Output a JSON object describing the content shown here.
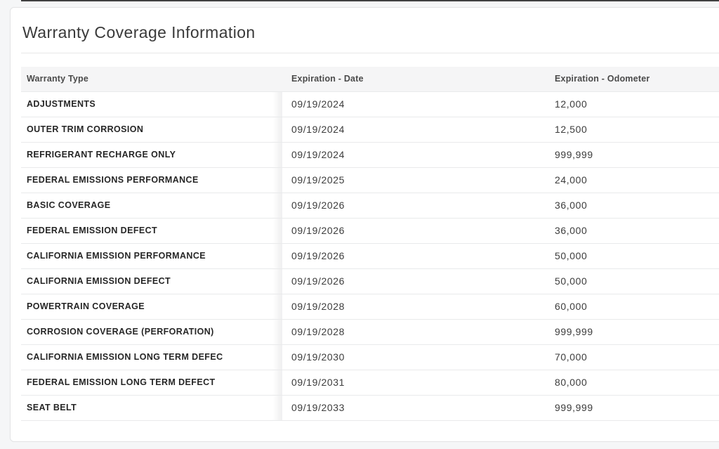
{
  "page": {
    "title": "Warranty Coverage Information"
  },
  "table": {
    "columns": [
      {
        "id": "type",
        "label": "Warranty Type"
      },
      {
        "id": "date",
        "label": "Expiration - Date"
      },
      {
        "id": "odometer",
        "label": "Expiration - Odometer"
      }
    ],
    "rows": [
      {
        "type": "ADJUSTMENTS",
        "date": "09/19/2024",
        "odometer": "12,000"
      },
      {
        "type": "OUTER TRIM CORROSION",
        "date": "09/19/2024",
        "odometer": "12,500"
      },
      {
        "type": "REFRIGERANT RECHARGE ONLY",
        "date": "09/19/2024",
        "odometer": "999,999"
      },
      {
        "type": "FEDERAL EMISSIONS PERFORMANCE",
        "date": "09/19/2025",
        "odometer": "24,000"
      },
      {
        "type": "BASIC COVERAGE",
        "date": "09/19/2026",
        "odometer": "36,000"
      },
      {
        "type": "FEDERAL EMISSION DEFECT",
        "date": "09/19/2026",
        "odometer": "36,000"
      },
      {
        "type": "CALIFORNIA EMISSION PERFORMANCE",
        "date": "09/19/2026",
        "odometer": "50,000"
      },
      {
        "type": "CALIFORNIA EMISSION DEFECT",
        "date": "09/19/2026",
        "odometer": "50,000"
      },
      {
        "type": "POWERTRAIN COVERAGE",
        "date": "09/19/2028",
        "odometer": "60,000"
      },
      {
        "type": "CORROSION COVERAGE (PERFORATION)",
        "date": "09/19/2028",
        "odometer": "999,999"
      },
      {
        "type": "CALIFORNIA EMISSION LONG TERM DEFEC",
        "date": "09/19/2030",
        "odometer": "70,000"
      },
      {
        "type": "FEDERAL EMISSION LONG TERM DEFECT",
        "date": "09/19/2031",
        "odometer": "80,000"
      },
      {
        "type": "SEAT BELT",
        "date": "09/19/2033",
        "odometer": "999,999"
      }
    ]
  },
  "colors": {
    "page-bg": "#f5f6f7",
    "card-bg": "#ffffff",
    "card-border": "#e2e3e4",
    "header-bg": "#f5f5f6",
    "row-border": "#e9eaeb",
    "title-text": "#3a3a3a",
    "cell-text": "#262626",
    "value-text": "#3c3c3c",
    "top-line": "#404040"
  }
}
